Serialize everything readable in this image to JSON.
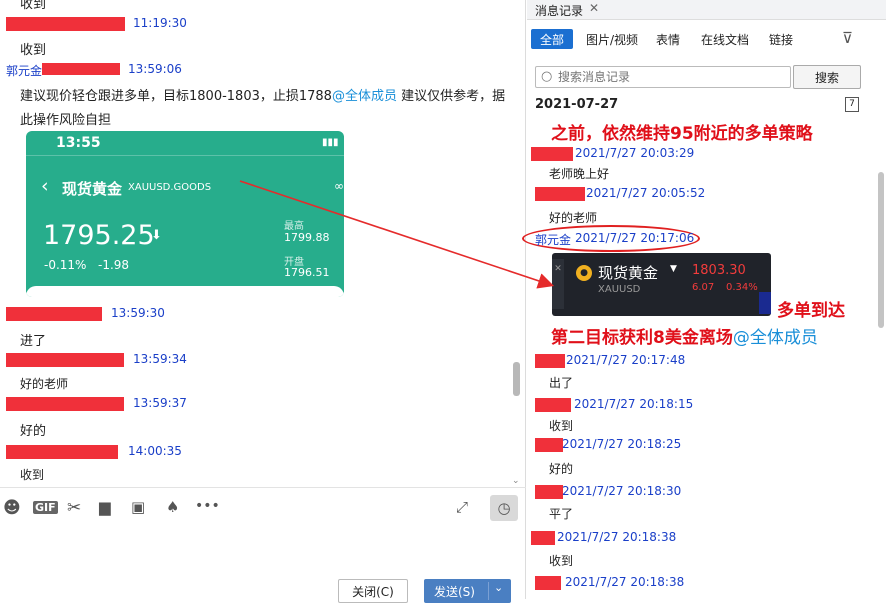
{
  "left": {
    "messages": [
      {
        "time": "11:19:30",
        "text": "收到"
      },
      {
        "name": "郭元金",
        "time": "13:59:06",
        "text_main": "建议现价轻仓跟进多单，目标1800-1803，止损1788",
        "mention": "@全体成员",
        "text_tail": " 建议仅供参考，据",
        "text_line2": "此操作风险自担"
      },
      {
        "time": "13:59:30",
        "text": "进了"
      },
      {
        "time": "13:59:34",
        "text": "好的老师"
      },
      {
        "time": "13:59:37",
        "text": "好的"
      },
      {
        "time": "14:00:35",
        "text": "收到"
      }
    ],
    "top_text": "收到",
    "phone": {
      "clock": "13:55",
      "title": "现货黄金",
      "code": "XAUUSD.GOODS",
      "price": "1795.25",
      "change_pct": "-0.11%",
      "change": "-1.98",
      "high_label": "最高",
      "high": "1799.88",
      "open_label": "开盘",
      "open": "1796.51"
    },
    "buttons": {
      "close": "关闭(C)",
      "send": "发送(S)"
    }
  },
  "right": {
    "tab_label": "消息记录",
    "filters": [
      "全部",
      "图片/视频",
      "表情",
      "在线文档",
      "链接"
    ],
    "search_placeholder": "搜索消息记录",
    "search_button": "搜索",
    "date": "2021-07-27",
    "calendar_day": "7",
    "anno1": "之前，依然维持95附近的多单策略",
    "anno2": "多单到达",
    "anno3": "第二目标获利8美金离场",
    "anno3_mention": "@全体成员",
    "records": [
      {
        "time": "2021/7/27 20:03:29",
        "text": "老师晚上好"
      },
      {
        "time": "2021/7/27 20:05:52",
        "text": "好的老师"
      },
      {
        "name": "郭元金",
        "time": "2021/7/27 20:17:06"
      },
      {
        "time": "2021/7/27 20:17:48",
        "text": "出了"
      },
      {
        "time": "2021/7/27 20:18:15",
        "text": "收到"
      },
      {
        "time": "2021/7/27 20:18:25",
        "text": "好的"
      },
      {
        "time": "2021/7/27 20:18:30",
        "text": "平了"
      },
      {
        "time": "2021/7/27 20:18:38",
        "text": "收到"
      },
      {
        "time": "2021/7/27 20:18:38"
      }
    ],
    "stock": {
      "title": "现货黄金",
      "code": "XAUUSD",
      "price": "1803.30",
      "change": "6.07",
      "pct": "0.34%"
    }
  }
}
